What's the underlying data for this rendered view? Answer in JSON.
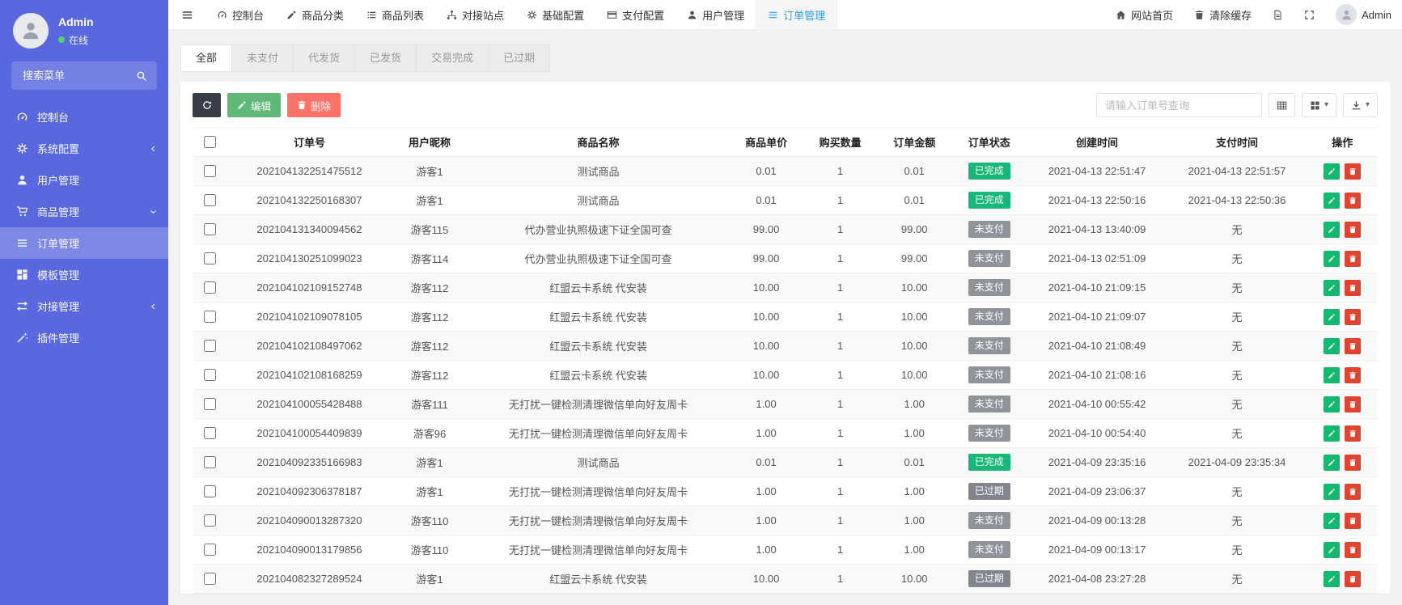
{
  "theme": {
    "sidebar-bg": "#5a68df",
    "accent-blue": "#1e9fff",
    "btn-dark": "#393d49",
    "btn-green": "#5fb878",
    "btn-red": "#fb7268",
    "op-green": "#13b96e",
    "op-red": "#e0432e"
  },
  "sidebar": {
    "user": {
      "name": "Admin",
      "status": "在线"
    },
    "search_placeholder": "搜索菜单",
    "items": [
      {
        "id": "dashboard",
        "label": "控制台",
        "icon": "gauge"
      },
      {
        "id": "system-config",
        "label": "系统配置",
        "icon": "gear",
        "arrow": "left"
      },
      {
        "id": "user-management",
        "label": "用户管理",
        "icon": "user"
      },
      {
        "id": "goods-management",
        "label": "商品管理",
        "icon": "cart",
        "arrow": "down"
      },
      {
        "id": "order-management",
        "label": "订单管理",
        "icon": "menu",
        "active": true
      },
      {
        "id": "template-management",
        "label": "模板管理",
        "icon": "template"
      },
      {
        "id": "docking-management",
        "label": "对接管理",
        "icon": "exchange",
        "arrow": "left"
      },
      {
        "id": "plugin-management",
        "label": "插件管理",
        "icon": "wand"
      }
    ]
  },
  "topbar": {
    "nav": [
      {
        "id": "dashboard",
        "label": "控制台",
        "icon": "gauge"
      },
      {
        "id": "goods-category",
        "label": "商品分类",
        "icon": "pencil"
      },
      {
        "id": "goods-list",
        "label": "商品列表",
        "icon": "list"
      },
      {
        "id": "docking-site",
        "label": "对接站点",
        "icon": "sitemap"
      },
      {
        "id": "basic-config",
        "label": "基础配置",
        "icon": "gear"
      },
      {
        "id": "payment-config",
        "label": "支付配置",
        "icon": "card"
      },
      {
        "id": "user-management",
        "label": "用户管理",
        "icon": "user"
      },
      {
        "id": "order-management",
        "label": "订单管理",
        "icon": "menu",
        "active": true
      }
    ],
    "home_label": "网站首页",
    "clear_cache_label": "清除缓存",
    "username": "Admin"
  },
  "tabs": {
    "items": [
      {
        "id": "all",
        "label": "全部",
        "active": true
      },
      {
        "id": "unpaid",
        "label": "未支付"
      },
      {
        "id": "to-deliver",
        "label": "代发货"
      },
      {
        "id": "delivered",
        "label": "已发货"
      },
      {
        "id": "completed",
        "label": "交易完成"
      },
      {
        "id": "expired",
        "label": "已过期"
      }
    ]
  },
  "toolbar": {
    "edit_label": "编辑",
    "delete_label": "删除",
    "search_placeholder": "请输入订单号查询"
  },
  "table": {
    "columns": [
      "订单号",
      "用户昵称",
      "商品名称",
      "商品单价",
      "购买数量",
      "订单金额",
      "订单状态",
      "创建时间",
      "支付时间",
      "操作"
    ],
    "column_ids": [
      "order-no",
      "nickname",
      "product-name",
      "unit-price",
      "quantity",
      "amount",
      "status",
      "created-time",
      "paid-time",
      "actions"
    ],
    "status_colors": {
      "已完成": "#16b777",
      "未支付": "#909399",
      "已过期": "#82848f"
    },
    "rows": [
      {
        "order_no": "202104132251475512",
        "nickname": "游客1",
        "product": "测试商品",
        "price": "0.01",
        "qty": "1",
        "amount": "0.01",
        "status": "已完成",
        "created_at": "2021-04-13 22:51:47",
        "paid_at": "2021-04-13 22:51:57"
      },
      {
        "order_no": "202104132250168307",
        "nickname": "游客1",
        "product": "测试商品",
        "price": "0.01",
        "qty": "1",
        "amount": "0.01",
        "status": "已完成",
        "created_at": "2021-04-13 22:50:16",
        "paid_at": "2021-04-13 22:50:36"
      },
      {
        "order_no": "202104131340094562",
        "nickname": "游客115",
        "product": "代办营业执照极速下证全国可查",
        "price": "99.00",
        "qty": "1",
        "amount": "99.00",
        "status": "未支付",
        "created_at": "2021-04-13 13:40:09",
        "paid_at": "无"
      },
      {
        "order_no": "202104130251099023",
        "nickname": "游客114",
        "product": "代办营业执照极速下证全国可查",
        "price": "99.00",
        "qty": "1",
        "amount": "99.00",
        "status": "未支付",
        "created_at": "2021-04-13 02:51:09",
        "paid_at": "无"
      },
      {
        "order_no": "202104102109152748",
        "nickname": "游客112",
        "product": "红盟云卡系统 代安装",
        "price": "10.00",
        "qty": "1",
        "amount": "10.00",
        "status": "未支付",
        "created_at": "2021-04-10 21:09:15",
        "paid_at": "无"
      },
      {
        "order_no": "202104102109078105",
        "nickname": "游客112",
        "product": "红盟云卡系统 代安装",
        "price": "10.00",
        "qty": "1",
        "amount": "10.00",
        "status": "未支付",
        "created_at": "2021-04-10 21:09:07",
        "paid_at": "无"
      },
      {
        "order_no": "202104102108497062",
        "nickname": "游客112",
        "product": "红盟云卡系统 代安装",
        "price": "10.00",
        "qty": "1",
        "amount": "10.00",
        "status": "未支付",
        "created_at": "2021-04-10 21:08:49",
        "paid_at": "无"
      },
      {
        "order_no": "202104102108168259",
        "nickname": "游客112",
        "product": "红盟云卡系统 代安装",
        "price": "10.00",
        "qty": "1",
        "amount": "10.00",
        "status": "未支付",
        "created_at": "2021-04-10 21:08:16",
        "paid_at": "无"
      },
      {
        "order_no": "202104100055428488",
        "nickname": "游客111",
        "product": "无打扰一键检测清理微信单向好友周卡",
        "price": "1.00",
        "qty": "1",
        "amount": "1.00",
        "status": "未支付",
        "created_at": "2021-04-10 00:55:42",
        "paid_at": "无"
      },
      {
        "order_no": "202104100054409839",
        "nickname": "游客96",
        "product": "无打扰一键检测清理微信单向好友周卡",
        "price": "1.00",
        "qty": "1",
        "amount": "1.00",
        "status": "未支付",
        "created_at": "2021-04-10 00:54:40",
        "paid_at": "无"
      },
      {
        "order_no": "202104092335166983",
        "nickname": "游客1",
        "product": "测试商品",
        "price": "0.01",
        "qty": "1",
        "amount": "0.01",
        "status": "已完成",
        "created_at": "2021-04-09 23:35:16",
        "paid_at": "2021-04-09 23:35:34"
      },
      {
        "order_no": "202104092306378187",
        "nickname": "游客1",
        "product": "无打扰一键检测清理微信单向好友周卡",
        "price": "1.00",
        "qty": "1",
        "amount": "1.00",
        "status": "已过期",
        "created_at": "2021-04-09 23:06:37",
        "paid_at": "无"
      },
      {
        "order_no": "202104090013287320",
        "nickname": "游客110",
        "product": "无打扰一键检测清理微信单向好友周卡",
        "price": "1.00",
        "qty": "1",
        "amount": "1.00",
        "status": "未支付",
        "created_at": "2021-04-09 00:13:28",
        "paid_at": "无"
      },
      {
        "order_no": "202104090013179856",
        "nickname": "游客110",
        "product": "无打扰一键检测清理微信单向好友周卡",
        "price": "1.00",
        "qty": "1",
        "amount": "1.00",
        "status": "未支付",
        "created_at": "2021-04-09 00:13:17",
        "paid_at": "无"
      },
      {
        "order_no": "202104082327289524",
        "nickname": "游客1",
        "product": "红盟云卡系统 代安装",
        "price": "10.00",
        "qty": "1",
        "amount": "10.00",
        "status": "已过期",
        "created_at": "2021-04-08 23:27:28",
        "paid_at": "无"
      }
    ]
  }
}
